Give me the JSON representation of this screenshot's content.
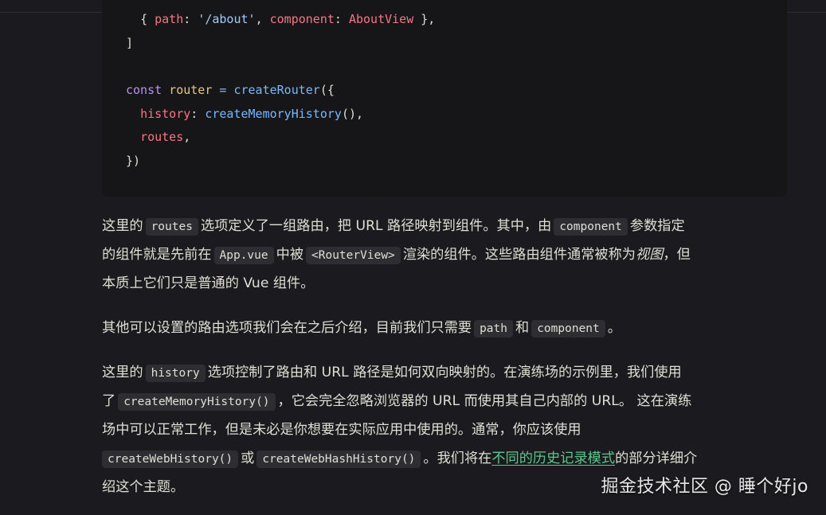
{
  "code": {
    "l1": {
      "open": "{ ",
      "path_key": "path",
      "colon1": ": ",
      "path_val": "'/about'",
      "sep": ", ",
      "comp_key": "component",
      "colon2": ": ",
      "comp_val": "AboutView",
      "close": " },"
    },
    "l2": "]",
    "l4": {
      "kw": "const",
      "var": "router",
      "eq": " = ",
      "fn": "createRouter",
      "paren": "({"
    },
    "l5": {
      "key": "history",
      "colon": ": ",
      "fn": "createMemoryHistory",
      "tail": "(),"
    },
    "l6": {
      "key": "routes",
      "tail": ","
    },
    "l7": "})"
  },
  "p1": {
    "a": "这里的",
    "c1": "routes",
    "b": "选项定义了一组路由，把 URL 路径映射到组件。其中，由",
    "c2": "component",
    "d": "参数指定",
    "e": "的组件就是先前在",
    "c3": "App.vue",
    "f": "中被",
    "c4": "<RouterView>",
    "g": "渲染的组件。这些路由组件通常被称为",
    "em": "视图",
    "h": "，但",
    "i": "本质上它们只是普通的 Vue 组件。"
  },
  "p2": {
    "a": "其他可以设置的路由选项我们会在之后介绍，目前我们只需要",
    "c1": "path",
    "b": "和",
    "c2": "component",
    "c": "。"
  },
  "p3": {
    "a": "这里的",
    "c1": "history",
    "b": "选项控制了路由和 URL 路径是如何双向映射的。在演练场的示例里，我们使用",
    "c": "了",
    "c2": "createMemoryHistory()",
    "d": "，它会完全忽略浏览器的 URL 而使用其自己内部的 URL。 这在演练",
    "e": "场中可以正常工作，但是未必是你想要在实际应用中使用的。通常，你应该使用",
    "c3": "createWebHistory()",
    "f": "或",
    "c4": "createWebHashHistory()",
    "g": "。我们将在",
    "link": "不同的历史记录模式",
    "h": "的部分详细介",
    "i": "绍这个主题。"
  },
  "watermark": "掘金技术社区 @ 睡个好jo"
}
